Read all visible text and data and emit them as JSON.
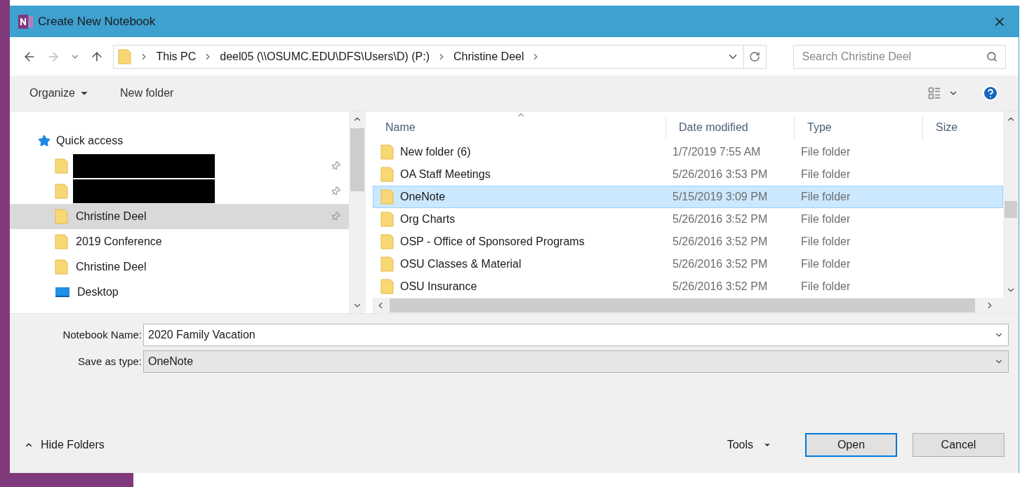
{
  "window": {
    "title": "Create New Notebook"
  },
  "address_bar": {
    "crumbs": [
      "This PC",
      "deel05 (\\\\OSUMC.EDU\\DFS\\Users\\D) (P:)",
      "Christine Deel"
    ]
  },
  "search": {
    "placeholder": "Search Christine Deel"
  },
  "toolbar": {
    "organize": "Organize",
    "new_folder": "New folder"
  },
  "nav": [
    {
      "kind": "group",
      "label": "Quick access",
      "pinned": false,
      "selected": false
    },
    {
      "kind": "redacted",
      "pinned": true,
      "selected": false
    },
    {
      "kind": "redacted",
      "pinned": true,
      "selected": false
    },
    {
      "kind": "folder",
      "label": "Christine Deel",
      "pinned": true,
      "selected": true
    },
    {
      "kind": "folder",
      "label": "2019 Conference",
      "pinned": false,
      "selected": false
    },
    {
      "kind": "folder",
      "label": "Christine Deel",
      "pinned": false,
      "selected": false
    },
    {
      "kind": "desktop",
      "label": "Desktop",
      "pinned": false,
      "selected": false
    }
  ],
  "table": {
    "columns": [
      "Name",
      "Date modified",
      "Type",
      "Size"
    ],
    "rows": [
      {
        "name": "New folder (6)",
        "date": "1/7/2019 7:55 AM",
        "type": "File folder",
        "selected": false
      },
      {
        "name": "OA Staff Meetings",
        "date": "5/26/2016 3:53 PM",
        "type": "File folder",
        "selected": false
      },
      {
        "name": "OneNote",
        "date": "5/15/2019 3:09 PM",
        "type": "File folder",
        "selected": true
      },
      {
        "name": "Org Charts",
        "date": "5/26/2016 3:52 PM",
        "type": "File folder",
        "selected": false
      },
      {
        "name": "OSP - Office of Sponsored Programs",
        "date": "5/26/2016 3:52 PM",
        "type": "File folder",
        "selected": false
      },
      {
        "name": "OSU Classes & Material",
        "date": "5/26/2016 3:52 PM",
        "type": "File folder",
        "selected": false
      },
      {
        "name": "OSU Insurance",
        "date": "5/26/2016 3:52 PM",
        "type": "File folder",
        "selected": false
      }
    ]
  },
  "fields": [
    {
      "kind": "text",
      "label": "Notebook Name:",
      "value": "2020 Family Vacation"
    },
    {
      "kind": "select",
      "label": "Save as type:",
      "value": "OneNote"
    }
  ],
  "hide_folders": "Hide Folders",
  "tools": "Tools",
  "buttons": [
    {
      "label": "Open",
      "default": true
    },
    {
      "label": "Cancel",
      "default": false
    }
  ]
}
